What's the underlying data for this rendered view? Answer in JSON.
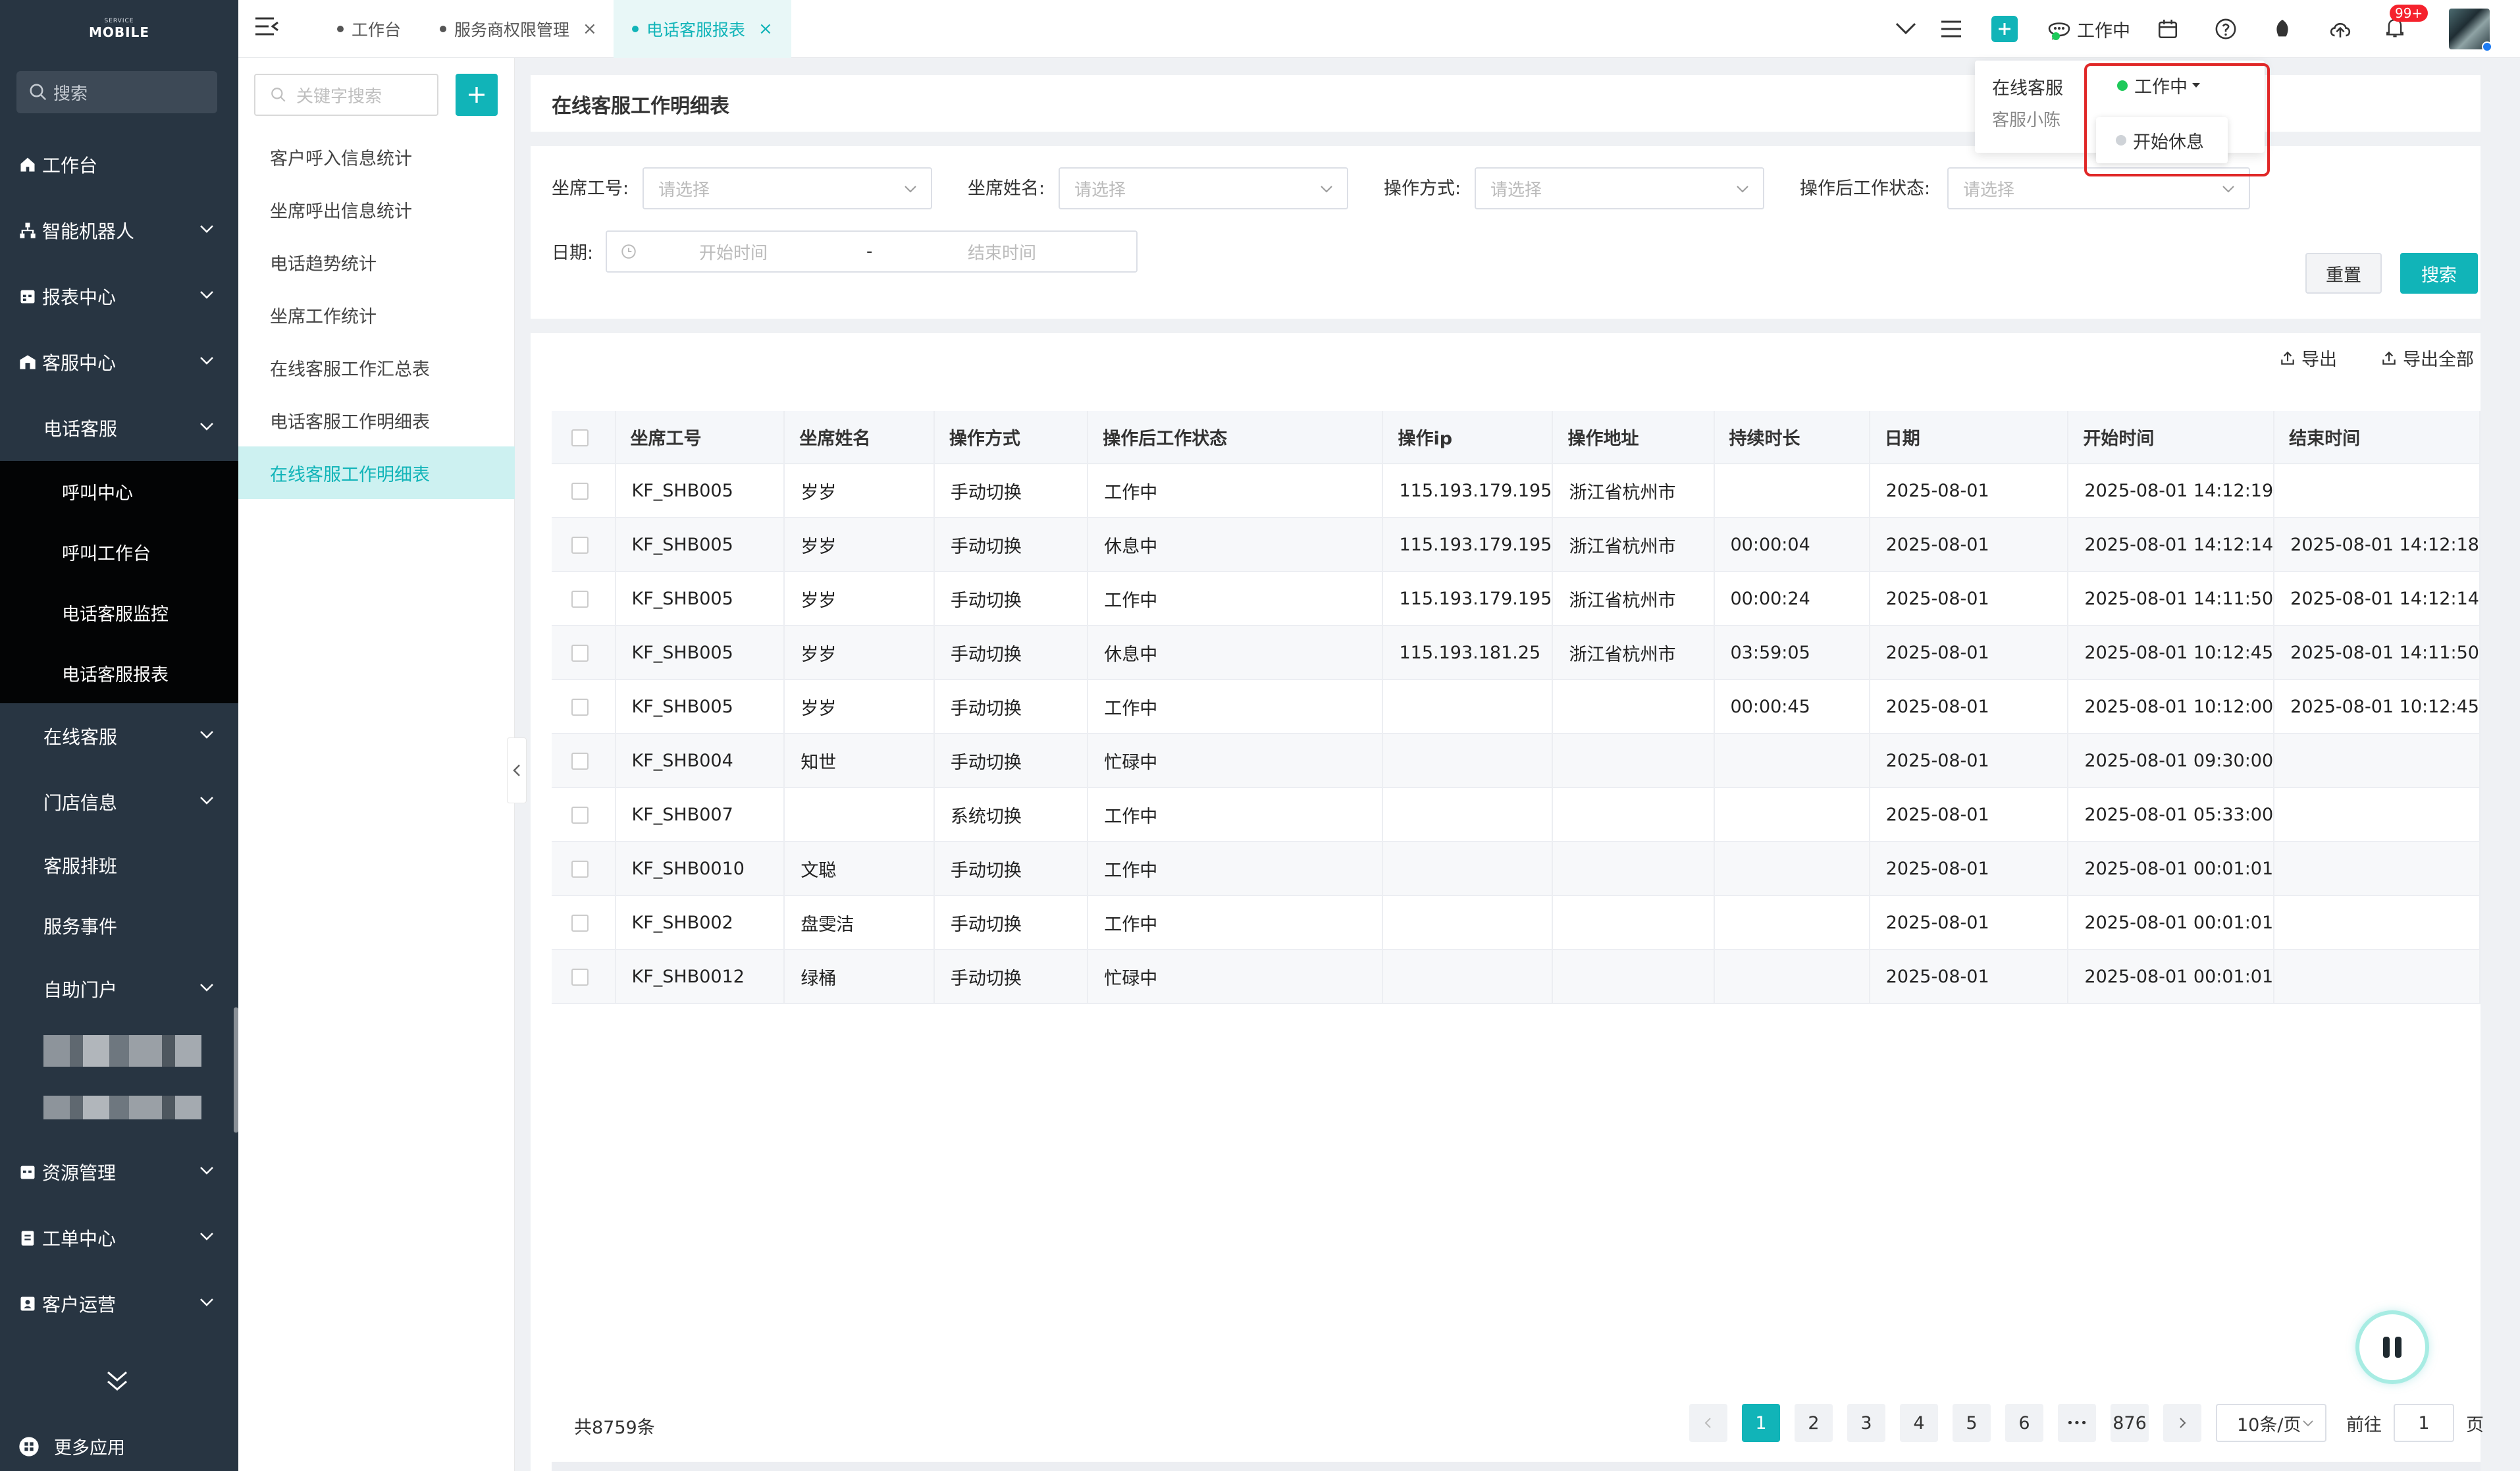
{
  "logo": {
    "small": "SERVICE",
    "main": "MOBILE"
  },
  "sidebar": {
    "search_placeholder": "搜索",
    "workbench": "工作台",
    "robot": "智能机器人",
    "report": "报表中心",
    "service_center": "客服中心",
    "phone_service": "电话客服",
    "phone_leaves": [
      "呼叫中心",
      "呼叫工作台",
      "电话客服监控",
      "电话客服报表"
    ],
    "online_service": "在线客服",
    "store_info": "门店信息",
    "schedule": "客服排班",
    "events": "服务事件",
    "self_portal": "自助门户",
    "resource": "资源管理",
    "tickets": "工单中心",
    "customer_ops": "客户运营",
    "more_apps": "更多应用"
  },
  "tabs": [
    {
      "label": "工作台",
      "active": false,
      "closable": false
    },
    {
      "label": "服务商权限管理",
      "active": false,
      "closable": true
    },
    {
      "label": "电话客服报表",
      "active": true,
      "closable": true
    }
  ],
  "topbar": {
    "status": "工作中",
    "badge": "99+"
  },
  "popover": {
    "title": "在线客服",
    "agent": "客服小陈",
    "status": "工作中",
    "option": "开始休息"
  },
  "subnav": {
    "search_placeholder": "关键字搜索",
    "items": [
      "客户呼入信息统计",
      "坐席呼出信息统计",
      "电话趋势统计",
      "坐席工作统计",
      "在线客服工作汇总表",
      "电话客服工作明细表",
      "在线客服工作明细表"
    ],
    "active_index": 6
  },
  "page": {
    "title": "在线客服工作明细表"
  },
  "filters": {
    "agent_id": "坐席工号:",
    "agent_name": "坐席姓名:",
    "op_method": "操作方式:",
    "after_status": "操作后工作状态:",
    "date": "日期:",
    "select_placeholder": "请选择",
    "start_placeholder": "开始时间",
    "end_placeholder": "结束时间",
    "range_sep": "-",
    "reset": "重置",
    "search": "搜索"
  },
  "toolbar": {
    "export": "导出",
    "export_all": "导出全部"
  },
  "table": {
    "columns": [
      "坐席工号",
      "坐席姓名",
      "操作方式",
      "操作后工作状态",
      "操作ip",
      "操作地址",
      "持续时长",
      "日期",
      "开始时间",
      "结束时间"
    ],
    "rows": [
      [
        "KF_SHB005",
        "岁岁",
        "手动切换",
        "工作中",
        "115.193.179.195",
        "浙江省杭州市",
        "",
        "2025-08-01",
        "2025-08-01 14:12:19",
        ""
      ],
      [
        "KF_SHB005",
        "岁岁",
        "手动切换",
        "休息中",
        "115.193.179.195",
        "浙江省杭州市",
        "00:00:04",
        "2025-08-01",
        "2025-08-01 14:12:14",
        "2025-08-01 14:12:18"
      ],
      [
        "KF_SHB005",
        "岁岁",
        "手动切换",
        "工作中",
        "115.193.179.195",
        "浙江省杭州市",
        "00:00:24",
        "2025-08-01",
        "2025-08-01 14:11:50",
        "2025-08-01 14:12:14"
      ],
      [
        "KF_SHB005",
        "岁岁",
        "手动切换",
        "休息中",
        "115.193.181.25",
        "浙江省杭州市",
        "03:59:05",
        "2025-08-01",
        "2025-08-01 10:12:45",
        "2025-08-01 14:11:50"
      ],
      [
        "KF_SHB005",
        "岁岁",
        "手动切换",
        "工作中",
        "",
        "",
        "00:00:45",
        "2025-08-01",
        "2025-08-01 10:12:00",
        "2025-08-01 10:12:45"
      ],
      [
        "KF_SHB004",
        "知世",
        "手动切换",
        "忙碌中",
        "",
        "",
        "",
        "2025-08-01",
        "2025-08-01 09:30:00",
        ""
      ],
      [
        "KF_SHB007",
        "",
        "系统切换",
        "工作中",
        "",
        "",
        "",
        "2025-08-01",
        "2025-08-01 05:33:00",
        ""
      ],
      [
        "KF_SHB0010",
        "文聪",
        "手动切换",
        "工作中",
        "",
        "",
        "",
        "2025-08-01",
        "2025-08-01 00:01:01",
        ""
      ],
      [
        "KF_SHB002",
        "盘雯洁",
        "手动切换",
        "工作中",
        "",
        "",
        "",
        "2025-08-01",
        "2025-08-01 00:01:01",
        ""
      ],
      [
        "KF_SHB0012",
        "绿桶",
        "手动切换",
        "忙碌中",
        "",
        "",
        "",
        "2025-08-01",
        "2025-08-01 00:01:01",
        ""
      ]
    ]
  },
  "pagination": {
    "total": "共8759条",
    "pages": [
      "1",
      "2",
      "3",
      "4",
      "5",
      "6"
    ],
    "ellipsis": "•••",
    "last": "876",
    "page_size": "10条/页",
    "goto_label": "前往",
    "goto_value": "1",
    "page_unit": "页"
  },
  "colors": {
    "accent": "#11b4b8",
    "sidebar": "#283542",
    "danger": "#e02727",
    "online": "#1ec95a"
  }
}
